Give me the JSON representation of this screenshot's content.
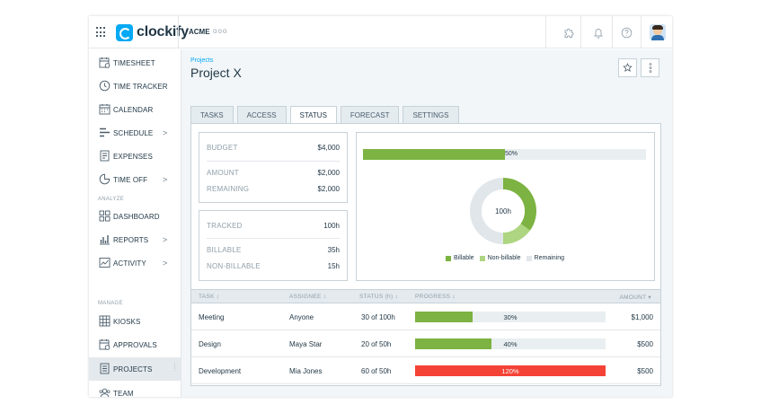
{
  "header": {
    "logo_text": "clockify",
    "workspace": "ACME",
    "workspace_more": "ooo"
  },
  "sidebar": {
    "items": [
      {
        "label": "TIMESHEET",
        "icon": "timesheet-icon"
      },
      {
        "label": "TIME TRACKER",
        "icon": "clock-icon"
      },
      {
        "label": "CALENDAR",
        "icon": "calendar-icon"
      },
      {
        "label": "SCHEDULE",
        "icon": "schedule-icon",
        "chevron": ">"
      },
      {
        "label": "EXPENSES",
        "icon": "expenses-icon"
      },
      {
        "label": "TIME OFF",
        "icon": "time-off-icon",
        "chevron": ">"
      }
    ],
    "analyze_label": "ANALYZE",
    "analyze_items": [
      {
        "label": "DASHBOARD",
        "icon": "dashboard-icon"
      },
      {
        "label": "REPORTS",
        "icon": "reports-icon",
        "chevron": ">"
      },
      {
        "label": "ACTIVITY",
        "icon": "activity-icon",
        "chevron": ">"
      }
    ],
    "manage_label": "MANAGE",
    "manage_items": [
      {
        "label": "KIOSKS",
        "icon": "kiosks-icon"
      },
      {
        "label": "APPROVALS",
        "icon": "approvals-icon"
      },
      {
        "label": "PROJECTS",
        "icon": "projects-icon",
        "active": true
      },
      {
        "label": "TEAM",
        "icon": "team-icon"
      }
    ]
  },
  "page": {
    "breadcrumb": "Projects",
    "title": "Project X"
  },
  "tabs": [
    {
      "label": "TASKS"
    },
    {
      "label": "ACCESS"
    },
    {
      "label": "STATUS",
      "active": true
    },
    {
      "label": "FORECAST"
    },
    {
      "label": "SETTINGS"
    }
  ],
  "budget_card": {
    "budget_label": "BUDGET",
    "budget_value": "$4,000",
    "amount_label": "AMOUNT",
    "amount_value": "$2,000",
    "remaining_label": "REMAINING",
    "remaining_value": "$2,000"
  },
  "tracked_card": {
    "tracked_label": "TRACKED",
    "tracked_value": "100h",
    "billable_label": "BILLABLE",
    "billable_value": "35h",
    "nonbillable_label": "NON-BILLABLE",
    "nonbillable_value": "15h"
  },
  "chart_data": [
    {
      "type": "bar",
      "categories": [
        ""
      ],
      "values": [
        50
      ],
      "xlim": [
        0,
        100
      ],
      "data_label": "50%",
      "color": "#7cb342"
    },
    {
      "type": "pie",
      "center_label": "100h",
      "labels": [
        "Billable",
        "Non-billable",
        "Remaining"
      ],
      "values": [
        35,
        15,
        50
      ],
      "colors": [
        "#7cb342",
        "#aed581",
        "#e0e6ea"
      ],
      "legend": "bottom"
    }
  ],
  "table": {
    "headers": {
      "task": "TASK ↕",
      "assignee": "ASSIGNEE ↕",
      "status": "STATUS (h) ↕",
      "progress": "PROGRESS ↕",
      "amount": "AMOUNT ▾"
    },
    "rows": [
      {
        "task": "Meeting",
        "assignee": "Anyone",
        "status": "30 of 100h",
        "progress": 30,
        "progress_label": "30%",
        "color": "#7cb342",
        "amount": "$1,000"
      },
      {
        "task": "Design",
        "assignee": "Maya Star",
        "status": "20 of 50h",
        "progress": 40,
        "progress_label": "40%",
        "color": "#7cb342",
        "amount": "$500"
      },
      {
        "task": "Development",
        "assignee": "Mia Jones",
        "status": "60 of 50h",
        "progress": 120,
        "progress_label": "120%",
        "color": "#f44336",
        "amount": "$500"
      }
    ]
  },
  "colors": {
    "accent": "#03a9f4",
    "green": "#7cb342",
    "light_green": "#aed581",
    "red": "#f44336"
  }
}
